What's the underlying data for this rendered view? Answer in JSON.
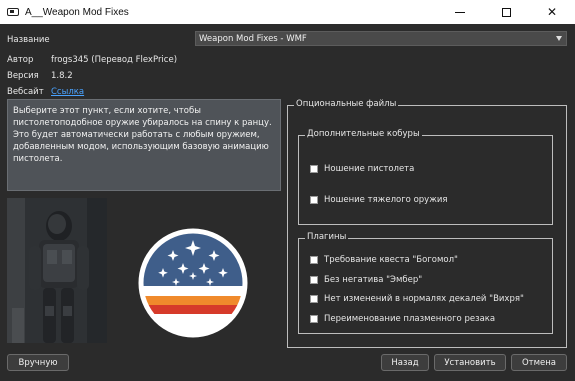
{
  "window": {
    "title": "A__Weapon Mod Fixes"
  },
  "info": {
    "name_label": "Название",
    "author_label": "Автор",
    "author_value": "frogs345 (Перевод FlexPrice)",
    "version_label": "Версия",
    "version_value": "1.8.2",
    "website_label": "Вебсайт",
    "website_link": "Ссылка"
  },
  "dropdown": {
    "selected": "Weapon Mod Fixes - WMF"
  },
  "description": "Выберите этот пункт, если хотите, чтобы пистолетоподобное оружие убиралось на спину к ранцу. Это будет автоматически работать с любым оружием, добавленным модом, использующим базовую анимацию пистолета.",
  "optional_files": {
    "title": "Опциональные файлы",
    "holsters": {
      "title": "Дополнительные кобуры",
      "options": [
        "Ношение пистолета",
        "Ношение тяжелого оружия"
      ]
    },
    "plugins": {
      "title": "Плагины",
      "options": [
        "Требование квеста \"Богомол\"",
        "Без негатива \"Эмбер\"",
        "Нет изменений в нормалях декалей \"Вихря\"",
        "Переименование плазменного резака"
      ]
    }
  },
  "buttons": {
    "manual": "Вручную",
    "back": "Назад",
    "install": "Установить",
    "cancel": "Отмена"
  },
  "colors": {
    "background": "#2b2b2b",
    "link": "#4aa3ff",
    "logo_blue": "#3f5e8a",
    "logo_orange": "#f08a2c",
    "logo_red": "#d63a2a"
  }
}
